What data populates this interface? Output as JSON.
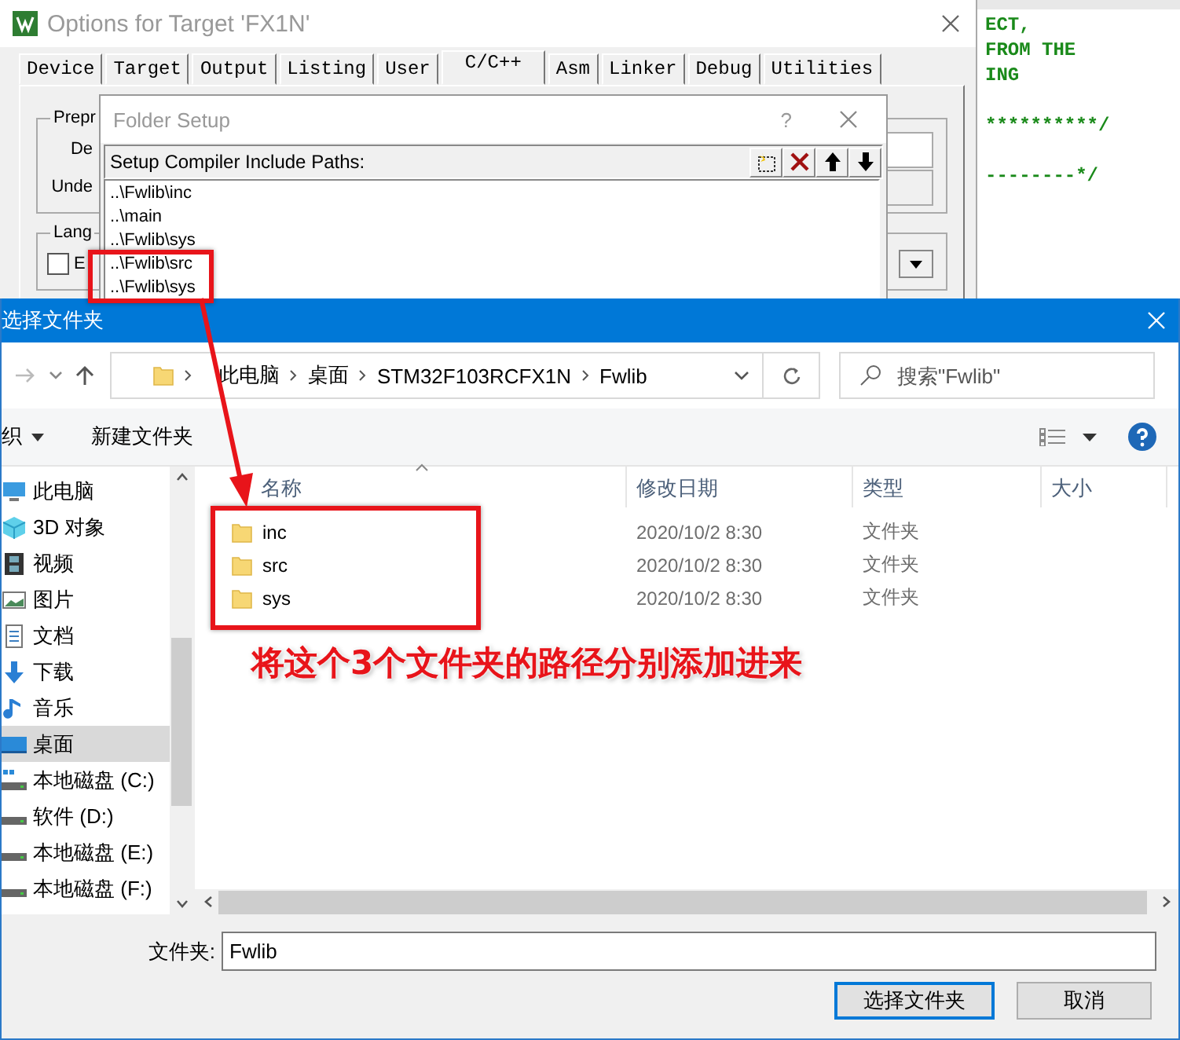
{
  "options_window": {
    "title": "Options for Target 'FX1N'",
    "tabs": [
      {
        "label": "Device",
        "selected": false
      },
      {
        "label": "Target",
        "selected": false
      },
      {
        "label": "Output",
        "selected": false
      },
      {
        "label": "Listing",
        "selected": false
      },
      {
        "label": "User",
        "selected": false
      },
      {
        "label": "C/C++",
        "selected": true
      },
      {
        "label": "Asm",
        "selected": false
      },
      {
        "label": "Linker",
        "selected": false
      },
      {
        "label": "Debug",
        "selected": false
      },
      {
        "label": "Utilities",
        "selected": false
      }
    ],
    "groups": [
      {
        "legend": "Prepr",
        "fields": [
          "De",
          "Unde"
        ]
      },
      {
        "legend": "Lang",
        "checkbox": {
          "label": "E",
          "checked": false
        }
      }
    ]
  },
  "code_editor": {
    "blocks": [
      [
        "ECT,",
        "FROM THE",
        "ING"
      ],
      [
        "**********/"
      ],
      [
        "--------*/"
      ]
    ]
  },
  "folder_setup": {
    "title": "Folder Setup",
    "help": "?",
    "list_label": "Setup Compiler Include Paths:",
    "paths": [
      "..\\Fwlib\\inc",
      "..\\main",
      "..\\Fwlib\\sys",
      "..\\Fwlib\\src",
      "..\\Fwlib\\sys"
    ]
  },
  "file_dialog": {
    "title": "选择文件夹",
    "breadcrumbs": [
      "此电脑",
      "桌面",
      "STM32F103RCFX1N",
      "Fwlib"
    ],
    "search": {
      "placeholder": "搜索\"Fwlib\""
    },
    "toolbar": {
      "organize": "织",
      "new_folder": "新建文件夹"
    },
    "sidebar": [
      {
        "label": "此电脑",
        "kind": "pc",
        "selected": false
      },
      {
        "label": "3D 对象",
        "kind": "objects",
        "selected": false
      },
      {
        "label": "视频",
        "kind": "video",
        "selected": false
      },
      {
        "label": "图片",
        "kind": "pictures",
        "selected": false
      },
      {
        "label": "文档",
        "kind": "documents",
        "selected": false
      },
      {
        "label": "下载",
        "kind": "downloads",
        "selected": false
      },
      {
        "label": "音乐",
        "kind": "music",
        "selected": false
      },
      {
        "label": "桌面",
        "kind": "desktop",
        "selected": true
      },
      {
        "label": "本地磁盘 (C:)",
        "kind": "system_drive",
        "selected": false
      },
      {
        "label": "软件 (D:)",
        "kind": "drive",
        "selected": false
      },
      {
        "label": "本地磁盘 (E:)",
        "kind": "drive",
        "selected": false
      },
      {
        "label": "本地磁盘 (F:)",
        "kind": "drive",
        "selected": false
      }
    ],
    "columns": [
      "名称",
      "修改日期",
      "类型",
      "大小"
    ],
    "rows": [
      {
        "name": "inc",
        "modified": "2020/10/2 8:30",
        "type": "文件夹"
      },
      {
        "name": "src",
        "modified": "2020/10/2 8:30",
        "type": "文件夹"
      },
      {
        "name": "sys",
        "modified": "2020/10/2 8:30",
        "type": "文件夹"
      }
    ],
    "folder_field": {
      "label": "文件夹:",
      "value": "Fwlib"
    },
    "buttons": [
      {
        "label": "选择文件夹",
        "default": true
      },
      {
        "label": "取消",
        "default": false
      }
    ]
  },
  "annotation": {
    "note": "将这个**3**个文件夹的路径分别添加进来"
  }
}
